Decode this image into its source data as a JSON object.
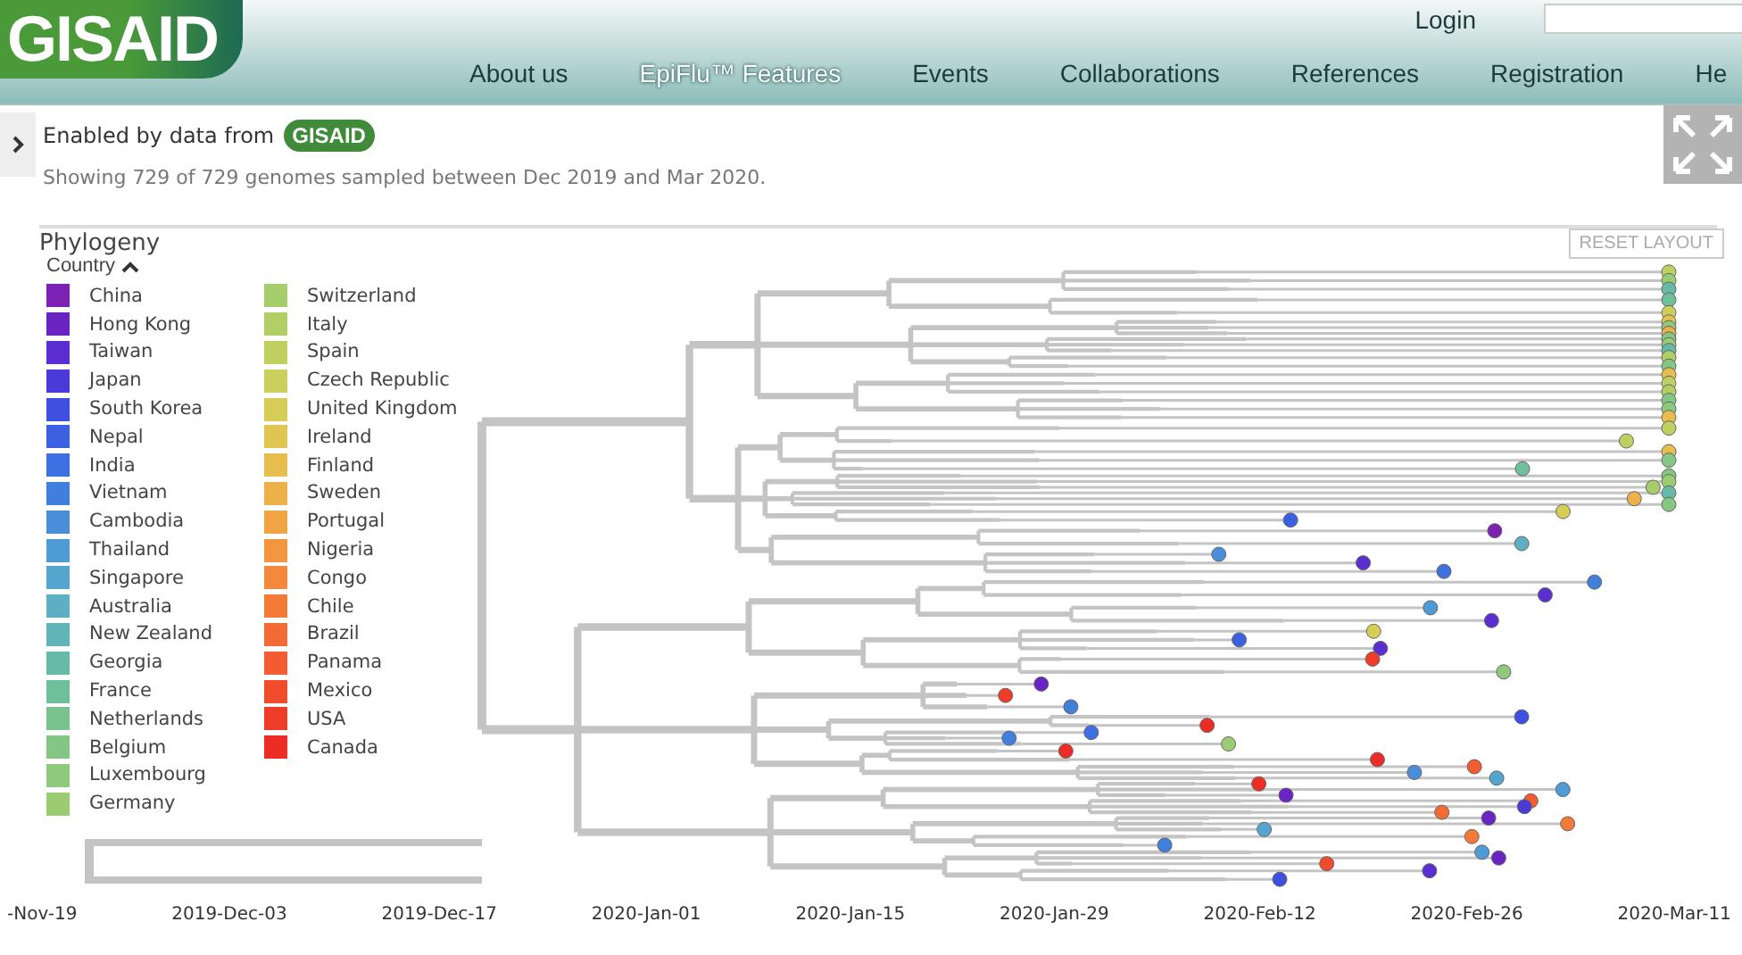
{
  "header": {
    "logo": "GISAID",
    "login": "Login",
    "nav": [
      {
        "label": "About us",
        "selected": false
      },
      {
        "label": "EpiFlu™ Features",
        "selected": true
      },
      {
        "label": "Events",
        "selected": false
      },
      {
        "label": "Collaborations",
        "selected": false
      },
      {
        "label": "References",
        "selected": false
      },
      {
        "label": "Registration",
        "selected": false
      },
      {
        "label": "He",
        "selected": false
      }
    ]
  },
  "info": {
    "enabled_text": "Enabled by data from",
    "badge": "GISAID",
    "summary": "Showing 729 of 729 genomes sampled between Dec 2019 and Mar 2020."
  },
  "panel": {
    "title": "Phylogeny",
    "reset_button": "RESET LAYOUT",
    "legend_title": "Country",
    "legend_expanded": true,
    "legend": [
      {
        "label": "China",
        "color": "#7b22b4"
      },
      {
        "label": "Hong Kong",
        "color": "#6a24c4"
      },
      {
        "label": "Taiwan",
        "color": "#5a2ed0"
      },
      {
        "label": "Japan",
        "color": "#4b3ad8"
      },
      {
        "label": "South Korea",
        "color": "#3f4fe0"
      },
      {
        "label": "Nepal",
        "color": "#3c60e2"
      },
      {
        "label": "India",
        "color": "#3d70e0"
      },
      {
        "label": "Vietnam",
        "color": "#417fdd"
      },
      {
        "label": "Cambodia",
        "color": "#4a8ed9"
      },
      {
        "label": "Thailand",
        "color": "#4f9bd6"
      },
      {
        "label": "Singapore",
        "color": "#55a6cf"
      },
      {
        "label": "Australia",
        "color": "#5eafc3"
      },
      {
        "label": "New Zealand",
        "color": "#62b5b6"
      },
      {
        "label": "Georgia",
        "color": "#68baa8"
      },
      {
        "label": "France",
        "color": "#70bf9b"
      },
      {
        "label": "Netherlands",
        "color": "#79c38f"
      },
      {
        "label": "Belgium",
        "color": "#84c684"
      },
      {
        "label": "Luxembourg",
        "color": "#8fc97b"
      },
      {
        "label": "Germany",
        "color": "#9bcb73"
      },
      {
        "label": "Switzerland",
        "color": "#a5cd6c"
      },
      {
        "label": "Italy",
        "color": "#b2cf66"
      },
      {
        "label": "Spain",
        "color": "#bfd060"
      },
      {
        "label": "Czech Republic",
        "color": "#cad05b"
      },
      {
        "label": "United Kingdom",
        "color": "#d5cd56"
      },
      {
        "label": "Ireland",
        "color": "#dfc652"
      },
      {
        "label": "Finland",
        "color": "#e7bd4d"
      },
      {
        "label": "Sweden",
        "color": "#edb149"
      },
      {
        "label": "Portugal",
        "color": "#f1a444"
      },
      {
        "label": "Nigeria",
        "color": "#f39640"
      },
      {
        "label": "Congo",
        "color": "#f4883c"
      },
      {
        "label": "Chile",
        "color": "#f47a38"
      },
      {
        "label": "Brazil",
        "color": "#f36b34"
      },
      {
        "label": "Panama",
        "color": "#f25c30"
      },
      {
        "label": "Mexico",
        "color": "#f04c2c"
      },
      {
        "label": "USA",
        "color": "#ee3c28"
      },
      {
        "label": "Canada",
        "color": "#ec2c25"
      }
    ],
    "axis_ticks": [
      "-Nov-19",
      "2019-Dec-03",
      "2019-Dec-17",
      "2020-Jan-01",
      "2020-Jan-15",
      "2020-Jan-29",
      "2020-Feb-12",
      "2020-Feb-26",
      "2020-Mar-11"
    ]
  }
}
